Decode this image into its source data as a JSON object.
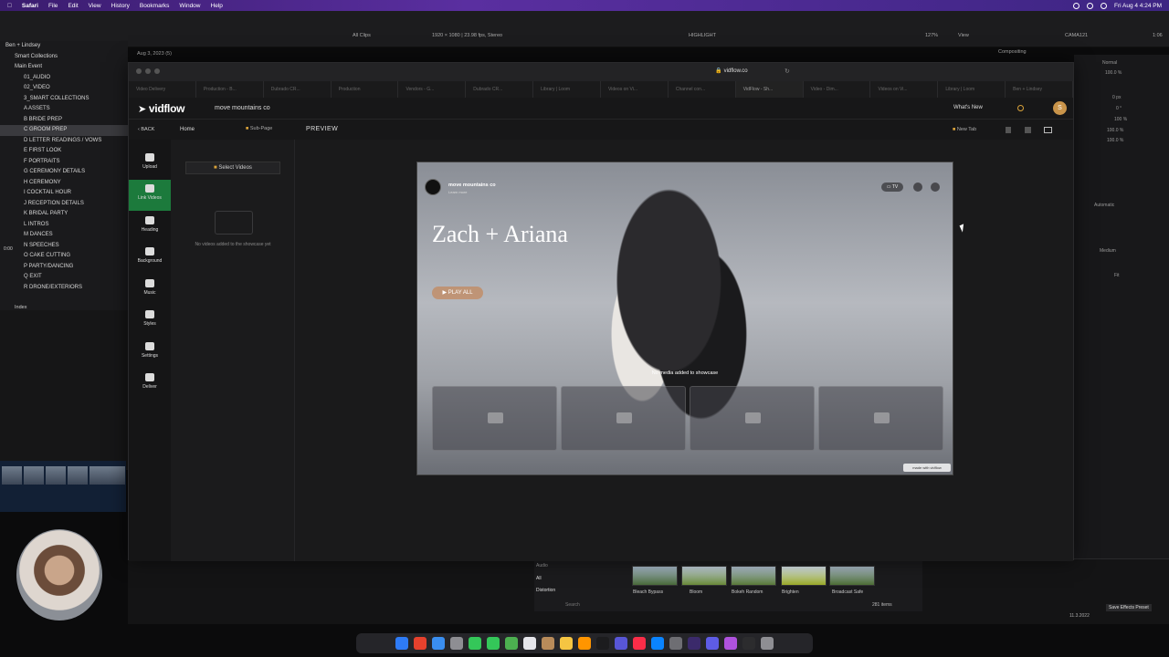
{
  "menubar": {
    "app": "Safari",
    "items": [
      "File",
      "Edit",
      "View",
      "History",
      "Bookmarks",
      "Window",
      "Help"
    ],
    "clock": "Fri Aug 4  4:24 PM"
  },
  "fcp": {
    "toolbar": {
      "all_clips": "All Clips",
      "format": "1920 × 1080 | 23.98 fps, Stereo",
      "highlight": "HIGHLIGHT",
      "zoom": "127%",
      "view": "View",
      "clip": "CAMA121",
      "timecode": "1:06",
      "compositing": "Compositing",
      "blend": "Normal"
    },
    "library": {
      "root": "Ben + Lindsey",
      "smart": "Smart Collections",
      "event": "Main Event",
      "date_header": "Aug 3, 2023",
      "date_count": "(5)",
      "items": [
        "01_AUDIO",
        "02_VIDEO",
        "3_SMART COLLECTIONS",
        "A ASSETS",
        "B BRIDE PREP",
        "C GROOM PREP",
        "D LETTER READINGS / VOWS",
        "E FIRST LOOK",
        "F PORTRAITS",
        "G CEREMONY DETAILS",
        "H CEREMONY",
        "I COCKTAIL HOUR",
        "J RECEPTION DETAILS",
        "K BRIDAL PARTY",
        "L INTROS",
        "M DANCES",
        "N SPEECHES",
        "O CAKE CUTTING",
        "P PARTY/DANCING",
        "Q EXIT",
        "R DRONE/EXTERIORS"
      ],
      "timecode_small": "0:00",
      "index": "Index"
    },
    "effects": {
      "categories": [
        "Audio",
        "All",
        "Distortion"
      ],
      "items": [
        "Bleach Bypass",
        "Bloom",
        "Bokeh Random",
        "Brighten",
        "Broadcast Safe"
      ],
      "count": "281 items",
      "search": "Search",
      "save_preset": "Save Effects Preset",
      "version": "11.3.2022"
    },
    "inspector": {
      "opacity": "100.0 %",
      "zero": "0 px",
      "rotation": "0 °",
      "scale": "100 %",
      "scale_x": "100.0 %",
      "scale_y": "100.0 %",
      "automatic": "Automatic",
      "medium": "Medium",
      "fit": "Fit"
    }
  },
  "safari": {
    "url": "vidflow.co",
    "tabs": [
      "Video Delivery",
      "Production - B...",
      "Dubrado CR...",
      "Production",
      "Vendors - G...",
      "Dubrado CR...",
      "Library | Loom",
      "Videos on Vi...",
      "Channel con...",
      "VidFlow - Sh...",
      "Video - Dim...",
      "Videos on Vi...",
      "Library | Loom",
      "Ben + Lindsey"
    ]
  },
  "vidflow": {
    "logo": "vidflow",
    "project": "move mountains co",
    "whats_new": "What's New",
    "avatar": "S",
    "back": "BACK",
    "home": "Home",
    "subpage": "Sub-Page",
    "preview_label": "PREVIEW",
    "new_tab": "New Tab",
    "rail": [
      "Upload",
      "Link Videos",
      "Heading",
      "Background",
      "Music",
      "Styles",
      "Settings",
      "Deliver"
    ],
    "select_videos": "Select Videos",
    "empty_text": "No videos added to the showcase yet",
    "preview": {
      "brand_name": "move mountains co",
      "brand_sub": "Learn more",
      "tv": "TV",
      "title": "Zach + Ariana",
      "play_all": "PLAY ALL",
      "no_media": "No media added to showcase",
      "made_with": "made with vidflow"
    }
  }
}
